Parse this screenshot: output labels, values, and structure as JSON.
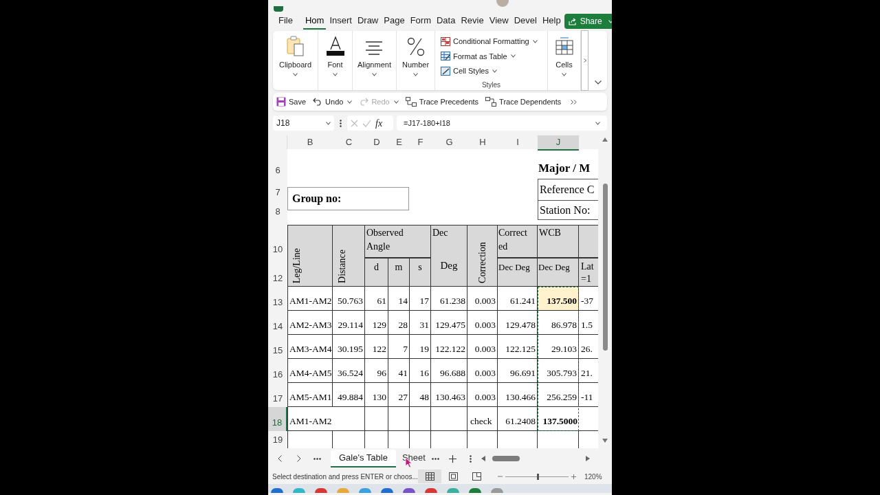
{
  "menu_tabs": [
    {
      "label": "File",
      "selected": false
    },
    {
      "label": "Hom",
      "selected": true
    },
    {
      "label": "Insert",
      "selected": false
    },
    {
      "label": "Draw",
      "selected": false
    },
    {
      "label": "Page",
      "selected": false
    },
    {
      "label": "Form",
      "selected": false
    },
    {
      "label": "Data",
      "selected": false
    },
    {
      "label": "Revie",
      "selected": false
    },
    {
      "label": "View",
      "selected": false
    },
    {
      "label": "Devel",
      "selected": false
    },
    {
      "label": "Help",
      "selected": false
    }
  ],
  "share_button": {
    "label": "Share"
  },
  "ribbon": {
    "groups": [
      {
        "kind": "clipboard",
        "label": "Clipboard"
      },
      {
        "kind": "font",
        "label": "Font"
      },
      {
        "kind": "alignment",
        "label": "Alignment"
      },
      {
        "kind": "number",
        "label": "Number"
      },
      {
        "kind": "styles",
        "label": "Styles",
        "items": [
          {
            "kind": "conditional",
            "label": "Conditional Formatting"
          },
          {
            "kind": "table",
            "label": "Format as Table"
          },
          {
            "kind": "cell_styles",
            "label": "Cell Styles"
          }
        ]
      },
      {
        "kind": "cells",
        "label": "Cells"
      }
    ]
  },
  "quick_access": [
    {
      "kind": "save",
      "label": "Save",
      "disabled": false
    },
    {
      "kind": "undo",
      "label": "Undo",
      "disabled": false
    },
    {
      "kind": "redo",
      "label": "Redo",
      "disabled": true
    },
    {
      "kind": "precedents",
      "label": "Trace Precedents",
      "disabled": false
    },
    {
      "kind": "dependents",
      "label": "Trace Dependents",
      "disabled": false
    }
  ],
  "formula_bar": {
    "name_box": "J18",
    "function_label": "fx",
    "formula": "=J17-180+I18"
  },
  "columns": [
    {
      "label": "B",
      "selected": false
    },
    {
      "label": "C",
      "selected": false
    },
    {
      "label": "D",
      "selected": false
    },
    {
      "label": "E",
      "selected": false
    },
    {
      "label": "F",
      "selected": false
    },
    {
      "label": "G",
      "selected": false
    },
    {
      "label": "H",
      "selected": false
    },
    {
      "label": "I",
      "selected": false
    },
    {
      "label": "J",
      "selected": true
    }
  ],
  "row_headers": [
    {
      "label": "6",
      "selected": false
    },
    {
      "label": "7",
      "selected": false
    },
    {
      "label": "8",
      "selected": false
    },
    {
      "label": "10",
      "selected": false
    },
    {
      "label": "12",
      "selected": false
    },
    {
      "label": "13",
      "selected": false
    },
    {
      "label": "14",
      "selected": false
    },
    {
      "label": "15",
      "selected": false
    },
    {
      "label": "16",
      "selected": false
    },
    {
      "label": "17",
      "selected": false
    },
    {
      "label": "18",
      "selected": true
    },
    {
      "label": "19",
      "selected": false
    }
  ],
  "sheet_texts": {
    "title": "Major / M",
    "group_label": "Group no:",
    "reference": "Reference C",
    "station": "Station No:"
  },
  "table_header": {
    "leg": "Leg/Line",
    "distance": "Distance",
    "observed": "Observed Angle",
    "d": "d",
    "m": "m",
    "s": "s",
    "dec_top": "Dec",
    "dec_bottom": "Deg",
    "correction": "Correction",
    "corrected_top": "Correct ed",
    "corrected_unit": "Dec Deg",
    "wcb_top": "WCB",
    "wcb_unit": "Dec Deg",
    "column_k": "Lat =1"
  },
  "rows": [
    {
      "kind": "data",
      "highlighted": true,
      "leg": "AM1-AM2",
      "distance": "50.763",
      "d": "61",
      "m": "14",
      "s": "17",
      "dec_deg": "61.238",
      "correction": "0.003",
      "corrected": "61.241",
      "wcb": "137.500",
      "column_k": "-37"
    },
    {
      "kind": "data",
      "highlighted": false,
      "leg": "AM2-AM3",
      "distance": "29.114",
      "d": "129",
      "m": "28",
      "s": "31",
      "dec_deg": "129.475",
      "correction": "0.003",
      "corrected": "129.478",
      "wcb": "86.978",
      "column_k": "1.5"
    },
    {
      "kind": "data",
      "highlighted": false,
      "leg": "AM3-AM4",
      "distance": "30.195",
      "d": "122",
      "m": "7",
      "s": "19",
      "dec_deg": "122.122",
      "correction": "0.003",
      "corrected": "122.125",
      "wcb": "29.103",
      "column_k": "26."
    },
    {
      "kind": "data",
      "highlighted": false,
      "leg": "AM4-AM5",
      "distance": "36.524",
      "d": "96",
      "m": "41",
      "s": "16",
      "dec_deg": "96.688",
      "correction": "0.003",
      "corrected": "96.691",
      "wcb": "305.793",
      "column_k": "21."
    },
    {
      "kind": "data",
      "highlighted": false,
      "leg": "AM5-AM1",
      "distance": "49.884",
      "d": "130",
      "m": "27",
      "s": "48",
      "dec_deg": "130.463",
      "correction": "0.003",
      "corrected": "130.466",
      "wcb": "256.259",
      "column_k": "-11"
    },
    {
      "kind": "check",
      "leg": "AM1-AM2",
      "label": "check",
      "corrected": "61.2408",
      "wcb": "137.5000"
    }
  ],
  "sheet_tabs": [
    {
      "label": "Gale's Table",
      "selected": true
    },
    {
      "label": "Sheet",
      "selected": false
    }
  ],
  "status_bar": {
    "message": "Select destination and press ENTER or choos...",
    "views": [
      {
        "kind": "normal",
        "selected": true
      },
      {
        "kind": "page_layout",
        "selected": false
      },
      {
        "kind": "page_break",
        "selected": false
      }
    ],
    "zoom_slider": {
      "level": 0.52
    },
    "zoom": "120%"
  }
}
